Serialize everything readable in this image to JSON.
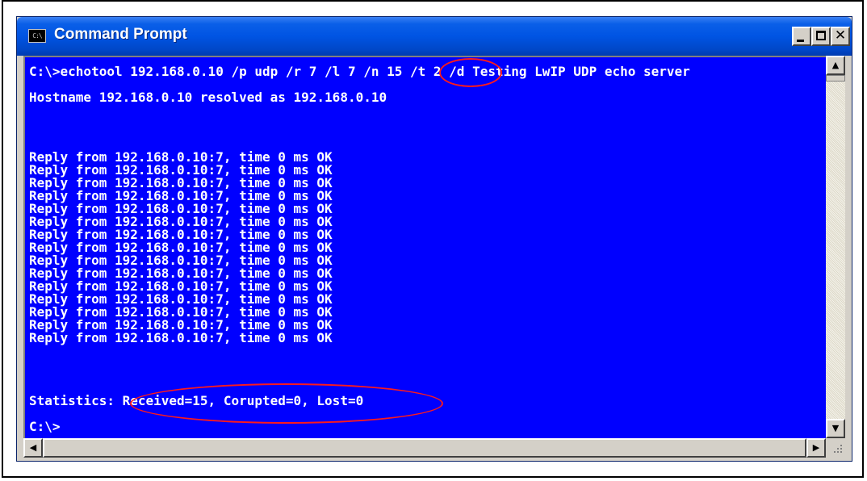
{
  "window": {
    "title": "Command Prompt",
    "icon_label": "C:\\"
  },
  "console": {
    "command": "C:\\>echotool 192.168.0.10 /p udp /r 7 /l 7 /n 15 /t 2 /d Testing LwIP UDP echo server",
    "resolved": "Hostname 192.168.0.10 resolved as 192.168.0.10",
    "replies": [
      "Reply from 192.168.0.10:7, time 0 ms OK",
      "Reply from 192.168.0.10:7, time 0 ms OK",
      "Reply from 192.168.0.10:7, time 0 ms OK",
      "Reply from 192.168.0.10:7, time 0 ms OK",
      "Reply from 192.168.0.10:7, time 0 ms OK",
      "Reply from 192.168.0.10:7, time 0 ms OK",
      "Reply from 192.168.0.10:7, time 0 ms OK",
      "Reply from 192.168.0.10:7, time 0 ms OK",
      "Reply from 192.168.0.10:7, time 0 ms OK",
      "Reply from 192.168.0.10:7, time 0 ms OK",
      "Reply from 192.168.0.10:7, time 0 ms OK",
      "Reply from 192.168.0.10:7, time 0 ms OK",
      "Reply from 192.168.0.10:7, time 0 ms OK",
      "Reply from 192.168.0.10:7, time 0 ms OK",
      "Reply from 192.168.0.10:7, time 0 ms OK"
    ],
    "statistics": "Statistics: Received=15, Corupted=0, Lost=0",
    "prompt": "C:\\>"
  },
  "colors": {
    "console_bg": "#0000ff",
    "console_fg": "#ffffff",
    "annotation": "#ff1a1a",
    "titlebar": "#0054e3"
  },
  "icons": [
    "cmd-icon",
    "minimize-icon",
    "maximize-icon",
    "close-icon",
    "scroll-up-icon",
    "scroll-down-icon",
    "scroll-left-icon",
    "scroll-right-icon",
    "resize-grip-icon"
  ]
}
